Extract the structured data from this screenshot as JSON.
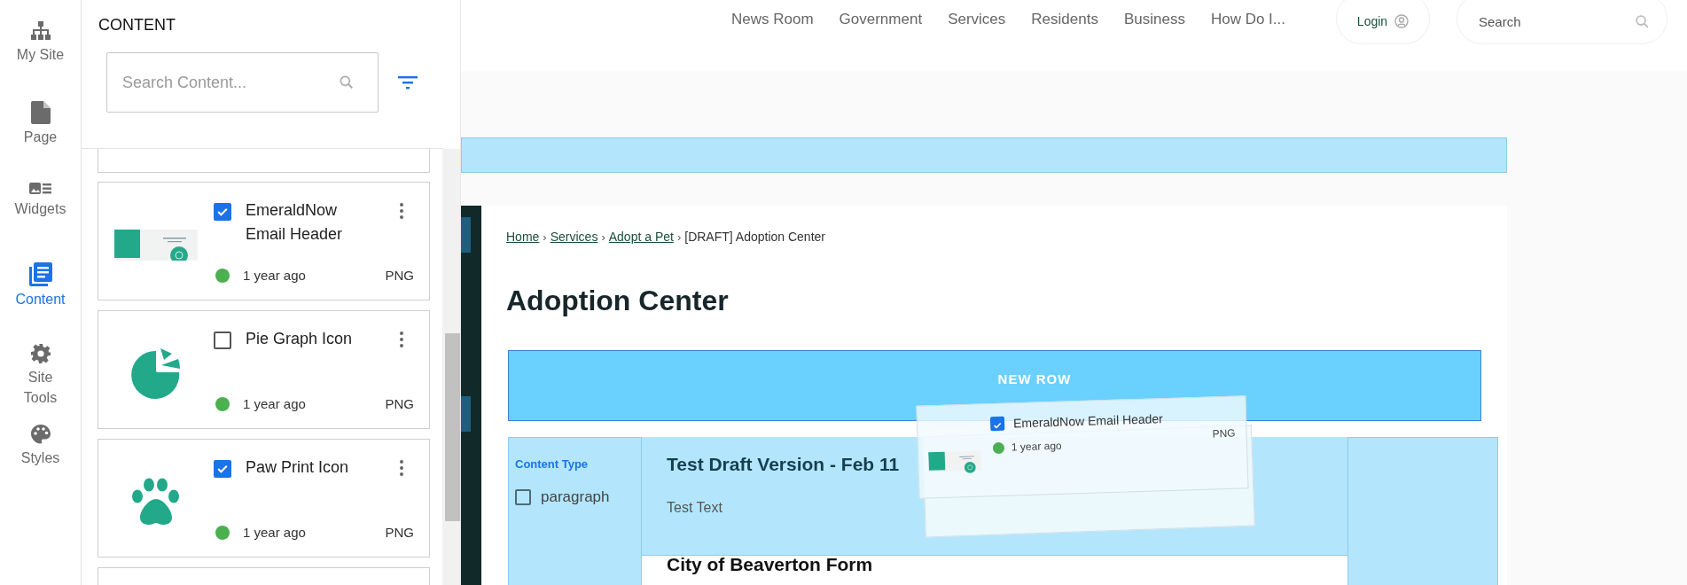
{
  "rail": [
    {
      "label": "My Site",
      "selected": false
    },
    {
      "label": "Page",
      "selected": false
    },
    {
      "label": "Widgets",
      "selected": false
    },
    {
      "label": "Content",
      "selected": true
    },
    {
      "label": "Site Tools",
      "selected": false
    },
    {
      "label": "Styles",
      "selected": false
    }
  ],
  "panel": {
    "title": "CONTENT",
    "search": {
      "placeholder": "Search Content..."
    },
    "items": [
      {
        "kind": "banner",
        "title": "EmeraldNow Email Header",
        "checked": true,
        "time": "1 year ago",
        "type": "PNG",
        "color": "#4caf50"
      },
      {
        "kind": "pie",
        "title": "Pie Graph Icon",
        "checked": false,
        "time": "1 year ago",
        "type": "PNG",
        "color": "#4caf50"
      },
      {
        "kind": "paw",
        "title": "Paw Print Icon",
        "checked": true,
        "time": "1 year ago",
        "type": "PNG",
        "color": "#4caf50"
      }
    ]
  },
  "nav": {
    "links": [
      "News Room",
      "Government",
      "Services",
      "Residents",
      "Business",
      "How Do I..."
    ],
    "login": "Login",
    "search": {
      "placeholder": "Search"
    }
  },
  "page": {
    "breadcrumb": [
      {
        "label": "Home",
        "link": true
      },
      {
        "label": "Services",
        "link": true
      },
      {
        "label": "Adopt a Pet",
        "link": true
      },
      {
        "label": "[DRAFT] Adoption Center",
        "link": false
      }
    ],
    "separator": "›",
    "title": "Adoption Center",
    "new_row": "NEW ROW",
    "filter": {
      "heading": "Content Type",
      "options": [
        {
          "label": "paragraph",
          "checked": false
        }
      ]
    },
    "block": {
      "heading": "Test Draft Version - Feb 11",
      "text": "Test Text"
    },
    "form_heading": "City of Beaverton Form"
  },
  "drag_ghost": {
    "kind": "banner",
    "title": "EmeraldNow Email Header",
    "checked": true,
    "time": "1 year ago",
    "type": "PNG",
    "color": "#4caf50"
  }
}
